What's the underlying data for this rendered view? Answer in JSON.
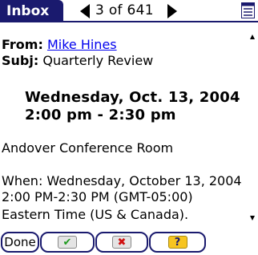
{
  "header": {
    "title": "Inbox",
    "message_position": "3 of 641",
    "accent_color": "#1a1a6e"
  },
  "message": {
    "from_label": "From:",
    "from_value": "Mike Hines",
    "subject_label": "Subj:",
    "subject_value": "Quarterly Review",
    "date_line": "Wednesday, Oct. 13, 2004",
    "time_line": "2:00 pm - 2:30 pm",
    "location": "Andover Conference Room",
    "details": [
      "When: Wednesday, October 13, 2004",
      "2:00 PM-2:30 PM (GMT-05:00)",
      "Eastern Time (US & Canada)."
    ]
  },
  "buttons": {
    "done_label": "Done",
    "accept_icon": "check-icon",
    "decline_icon": "x-icon",
    "tentative_icon": "question-icon",
    "accept_glyph": "✔",
    "decline_glyph": "✖",
    "tentative_glyph": "?"
  }
}
